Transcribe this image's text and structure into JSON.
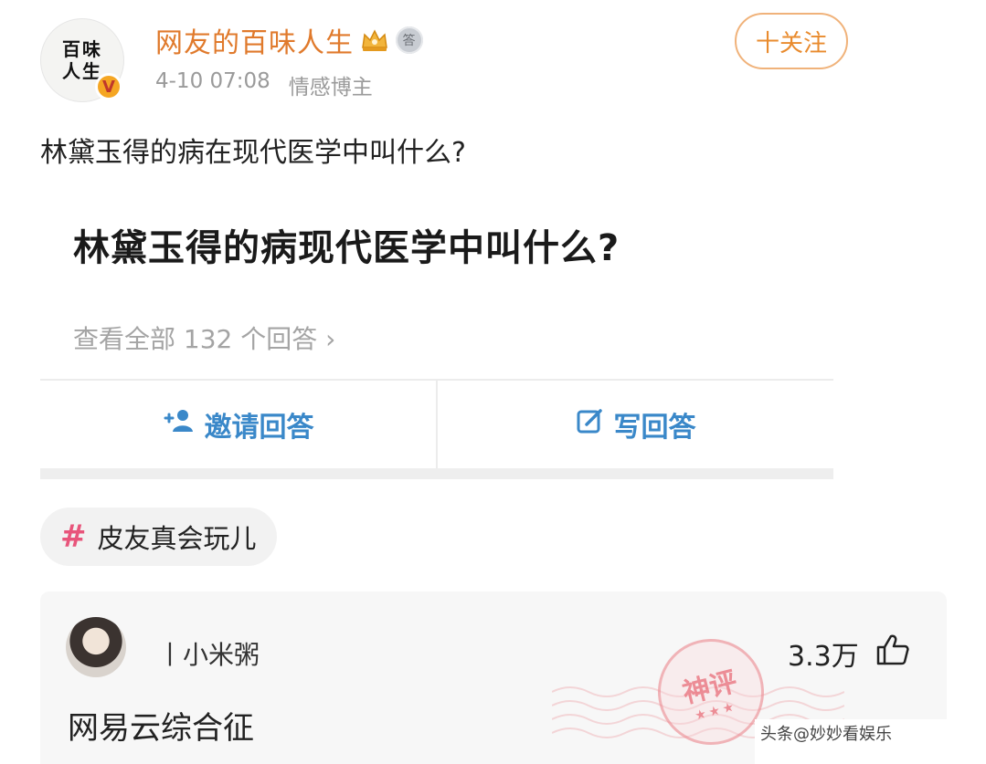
{
  "post": {
    "avatar_text": [
      "百味",
      "人生"
    ],
    "verified_mark": "V",
    "username": "网友的百味人生",
    "time": "4-10 07:08",
    "author_tag": "情感博主",
    "follow_label": "十关注",
    "text": "林黛玉得的病在现代医学中叫什么?"
  },
  "card": {
    "question_title": "林黛玉得的病现代医学中叫什么?",
    "view_all": "查看全部 132 个回答 ›",
    "invite_label": "邀请回答",
    "write_label": "写回答"
  },
  "topic": {
    "hash": "#",
    "label": "皮友真会玩儿"
  },
  "comment": {
    "username": "丨小米粥",
    "likes": "3.3万",
    "text": "网易云综合征",
    "stamp_text": "神评",
    "stamp_stars": "★★★"
  },
  "watermark": "头条@妙妙看娱乐"
}
